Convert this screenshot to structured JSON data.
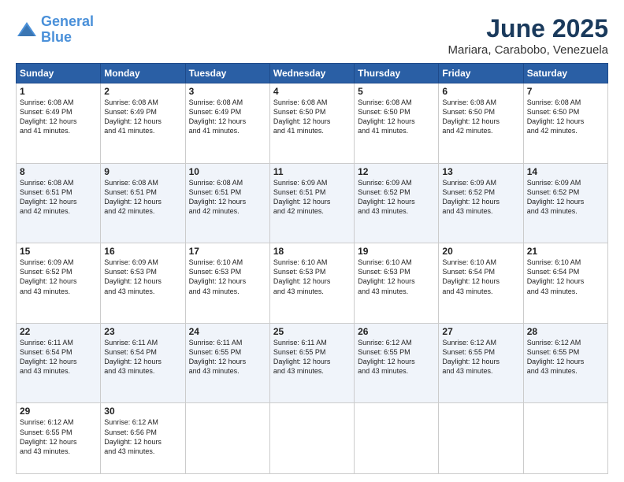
{
  "header": {
    "logo_line1": "General",
    "logo_line2": "Blue",
    "month": "June 2025",
    "location": "Mariara, Carabobo, Venezuela"
  },
  "weekdays": [
    "Sunday",
    "Monday",
    "Tuesday",
    "Wednesday",
    "Thursday",
    "Friday",
    "Saturday"
  ],
  "weeks": [
    [
      {
        "day": "1",
        "lines": [
          "Sunrise: 6:08 AM",
          "Sunset: 6:49 PM",
          "Daylight: 12 hours",
          "and 41 minutes."
        ]
      },
      {
        "day": "2",
        "lines": [
          "Sunrise: 6:08 AM",
          "Sunset: 6:49 PM",
          "Daylight: 12 hours",
          "and 41 minutes."
        ]
      },
      {
        "day": "3",
        "lines": [
          "Sunrise: 6:08 AM",
          "Sunset: 6:49 PM",
          "Daylight: 12 hours",
          "and 41 minutes."
        ]
      },
      {
        "day": "4",
        "lines": [
          "Sunrise: 6:08 AM",
          "Sunset: 6:50 PM",
          "Daylight: 12 hours",
          "and 41 minutes."
        ]
      },
      {
        "day": "5",
        "lines": [
          "Sunrise: 6:08 AM",
          "Sunset: 6:50 PM",
          "Daylight: 12 hours",
          "and 41 minutes."
        ]
      },
      {
        "day": "6",
        "lines": [
          "Sunrise: 6:08 AM",
          "Sunset: 6:50 PM",
          "Daylight: 12 hours",
          "and 42 minutes."
        ]
      },
      {
        "day": "7",
        "lines": [
          "Sunrise: 6:08 AM",
          "Sunset: 6:50 PM",
          "Daylight: 12 hours",
          "and 42 minutes."
        ]
      }
    ],
    [
      {
        "day": "8",
        "lines": [
          "Sunrise: 6:08 AM",
          "Sunset: 6:51 PM",
          "Daylight: 12 hours",
          "and 42 minutes."
        ]
      },
      {
        "day": "9",
        "lines": [
          "Sunrise: 6:08 AM",
          "Sunset: 6:51 PM",
          "Daylight: 12 hours",
          "and 42 minutes."
        ]
      },
      {
        "day": "10",
        "lines": [
          "Sunrise: 6:08 AM",
          "Sunset: 6:51 PM",
          "Daylight: 12 hours",
          "and 42 minutes."
        ]
      },
      {
        "day": "11",
        "lines": [
          "Sunrise: 6:09 AM",
          "Sunset: 6:51 PM",
          "Daylight: 12 hours",
          "and 42 minutes."
        ]
      },
      {
        "day": "12",
        "lines": [
          "Sunrise: 6:09 AM",
          "Sunset: 6:52 PM",
          "Daylight: 12 hours",
          "and 43 minutes."
        ]
      },
      {
        "day": "13",
        "lines": [
          "Sunrise: 6:09 AM",
          "Sunset: 6:52 PM",
          "Daylight: 12 hours",
          "and 43 minutes."
        ]
      },
      {
        "day": "14",
        "lines": [
          "Sunrise: 6:09 AM",
          "Sunset: 6:52 PM",
          "Daylight: 12 hours",
          "and 43 minutes."
        ]
      }
    ],
    [
      {
        "day": "15",
        "lines": [
          "Sunrise: 6:09 AM",
          "Sunset: 6:52 PM",
          "Daylight: 12 hours",
          "and 43 minutes."
        ]
      },
      {
        "day": "16",
        "lines": [
          "Sunrise: 6:09 AM",
          "Sunset: 6:53 PM",
          "Daylight: 12 hours",
          "and 43 minutes."
        ]
      },
      {
        "day": "17",
        "lines": [
          "Sunrise: 6:10 AM",
          "Sunset: 6:53 PM",
          "Daylight: 12 hours",
          "and 43 minutes."
        ]
      },
      {
        "day": "18",
        "lines": [
          "Sunrise: 6:10 AM",
          "Sunset: 6:53 PM",
          "Daylight: 12 hours",
          "and 43 minutes."
        ]
      },
      {
        "day": "19",
        "lines": [
          "Sunrise: 6:10 AM",
          "Sunset: 6:53 PM",
          "Daylight: 12 hours",
          "and 43 minutes."
        ]
      },
      {
        "day": "20",
        "lines": [
          "Sunrise: 6:10 AM",
          "Sunset: 6:54 PM",
          "Daylight: 12 hours",
          "and 43 minutes."
        ]
      },
      {
        "day": "21",
        "lines": [
          "Sunrise: 6:10 AM",
          "Sunset: 6:54 PM",
          "Daylight: 12 hours",
          "and 43 minutes."
        ]
      }
    ],
    [
      {
        "day": "22",
        "lines": [
          "Sunrise: 6:11 AM",
          "Sunset: 6:54 PM",
          "Daylight: 12 hours",
          "and 43 minutes."
        ]
      },
      {
        "day": "23",
        "lines": [
          "Sunrise: 6:11 AM",
          "Sunset: 6:54 PM",
          "Daylight: 12 hours",
          "and 43 minutes."
        ]
      },
      {
        "day": "24",
        "lines": [
          "Sunrise: 6:11 AM",
          "Sunset: 6:55 PM",
          "Daylight: 12 hours",
          "and 43 minutes."
        ]
      },
      {
        "day": "25",
        "lines": [
          "Sunrise: 6:11 AM",
          "Sunset: 6:55 PM",
          "Daylight: 12 hours",
          "and 43 minutes."
        ]
      },
      {
        "day": "26",
        "lines": [
          "Sunrise: 6:12 AM",
          "Sunset: 6:55 PM",
          "Daylight: 12 hours",
          "and 43 minutes."
        ]
      },
      {
        "day": "27",
        "lines": [
          "Sunrise: 6:12 AM",
          "Sunset: 6:55 PM",
          "Daylight: 12 hours",
          "and 43 minutes."
        ]
      },
      {
        "day": "28",
        "lines": [
          "Sunrise: 6:12 AM",
          "Sunset: 6:55 PM",
          "Daylight: 12 hours",
          "and 43 minutes."
        ]
      }
    ],
    [
      {
        "day": "29",
        "lines": [
          "Sunrise: 6:12 AM",
          "Sunset: 6:55 PM",
          "Daylight: 12 hours",
          "and 43 minutes."
        ]
      },
      {
        "day": "30",
        "lines": [
          "Sunrise: 6:12 AM",
          "Sunset: 6:56 PM",
          "Daylight: 12 hours",
          "and 43 minutes."
        ]
      },
      {
        "day": "",
        "lines": []
      },
      {
        "day": "",
        "lines": []
      },
      {
        "day": "",
        "lines": []
      },
      {
        "day": "",
        "lines": []
      },
      {
        "day": "",
        "lines": []
      }
    ]
  ]
}
